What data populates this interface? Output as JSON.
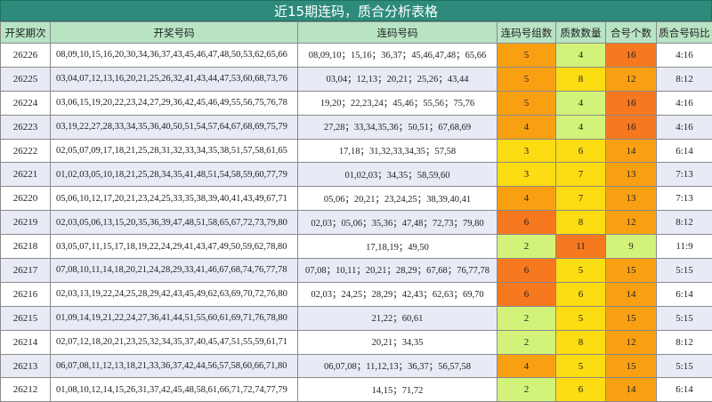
{
  "title": "近15期连码，质合分析表格",
  "headers": [
    "开奖期次",
    "开奖号码",
    "连码号码",
    "连码号组数",
    "质数数量",
    "合号个数",
    "质合号码比"
  ],
  "colors": {
    "red": "#f6781f",
    "orange": "#f9a012",
    "yellow": "#fcdc12",
    "light": "#d3f27a"
  },
  "rows": [
    {
      "issue": "26226",
      "draw": "08,09,10,15,16,20,30,34,36,37,43,45,46,47,48,50,53,62,65,66",
      "lian": "08,09,10；15,16；36,37；45,46,47,48；65,66",
      "groups": "5",
      "gc": "orange",
      "prime": "4",
      "pc": "light",
      "composite": "16",
      "cc": "red",
      "ratio": "4:16"
    },
    {
      "issue": "26225",
      "draw": "03,04,07,12,13,16,20,21,25,26,32,41,43,44,47,53,60,68,73,76",
      "lian": "03,04；12,13；20,21；25,26；43,44",
      "groups": "5",
      "gc": "orange",
      "prime": "8",
      "pc": "yellow",
      "composite": "12",
      "cc": "orange",
      "ratio": "8:12"
    },
    {
      "issue": "26224",
      "draw": "03,06,15,19,20,22,23,24,27,29,36,42,45,46,49,55,56,75,76,78",
      "lian": "19,20；22,23,24；45,46；55,56；75,76",
      "groups": "5",
      "gc": "orange",
      "prime": "4",
      "pc": "light",
      "composite": "16",
      "cc": "red",
      "ratio": "4:16"
    },
    {
      "issue": "26223",
      "draw": "03,19,22,27,28,33,34,35,36,40,50,51,54,57,64,67,68,69,75,79",
      "lian": "27,28；33,34,35,36；50,51；67,68,69",
      "groups": "4",
      "gc": "orange",
      "prime": "4",
      "pc": "light",
      "composite": "16",
      "cc": "red",
      "ratio": "4:16"
    },
    {
      "issue": "26222",
      "draw": "02,05,07,09,17,18,21,25,28,31,32,33,34,35,38,51,57,58,61,65",
      "lian": "17,18；31,32,33,34,35；57,58",
      "groups": "3",
      "gc": "yellow",
      "prime": "6",
      "pc": "yellow",
      "composite": "14",
      "cc": "orange",
      "ratio": "6:14"
    },
    {
      "issue": "26221",
      "draw": "01,02,03,05,10,18,21,25,28,34,35,41,48,51,54,58,59,60,77,79",
      "lian": "01,02,03；34,35；58,59,60",
      "groups": "3",
      "gc": "yellow",
      "prime": "7",
      "pc": "yellow",
      "composite": "13",
      "cc": "orange",
      "ratio": "7:13"
    },
    {
      "issue": "26220",
      "draw": "05,06,10,12,17,20,21,23,24,25,33,35,38,39,40,41,43,49,67,71",
      "lian": "05,06；20,21；23,24,25；38,39,40,41",
      "groups": "4",
      "gc": "orange",
      "prime": "7",
      "pc": "yellow",
      "composite": "13",
      "cc": "orange",
      "ratio": "7:13"
    },
    {
      "issue": "26219",
      "draw": "02,03,05,06,13,15,20,35,36,39,47,48,51,58,65,67,72,73,79,80",
      "lian": "02,03；05,06；35,36；47,48；72,73；79,80",
      "groups": "6",
      "gc": "red",
      "prime": "8",
      "pc": "yellow",
      "composite": "12",
      "cc": "orange",
      "ratio": "8:12"
    },
    {
      "issue": "26218",
      "draw": "03,05,07,11,15,17,18,19,22,24,29,41,43,47,49,50,59,62,78,80",
      "lian": "17,18,19；49,50",
      "groups": "2",
      "gc": "light",
      "prime": "11",
      "pc": "red",
      "composite": "9",
      "cc": "light",
      "ratio": "11:9"
    },
    {
      "issue": "26217",
      "draw": "07,08,10,11,14,18,20,21,24,28,29,33,41,46,67,68,74,76,77,78",
      "lian": "07,08；10,11；20,21；28,29；67,68；76,77,78",
      "groups": "6",
      "gc": "red",
      "prime": "5",
      "pc": "yellow",
      "composite": "15",
      "cc": "orange",
      "ratio": "5:15"
    },
    {
      "issue": "26216",
      "draw": "02,03,13,19,22,24,25,28,29,42,43,45,49,62,63,69,70,72,76,80",
      "lian": "02,03；24,25；28,29；42,43；62,63；69,70",
      "groups": "6",
      "gc": "red",
      "prime": "6",
      "pc": "yellow",
      "composite": "14",
      "cc": "orange",
      "ratio": "6:14"
    },
    {
      "issue": "26215",
      "draw": "01,09,14,19,21,22,24,27,36,41,44,51,55,60,61,69,71,76,78,80",
      "lian": "21,22；60,61",
      "groups": "2",
      "gc": "light",
      "prime": "5",
      "pc": "yellow",
      "composite": "15",
      "cc": "orange",
      "ratio": "5:15"
    },
    {
      "issue": "26214",
      "draw": "02,07,12,18,20,21,23,25,32,34,35,37,40,45,47,51,55,59,61,71",
      "lian": "20,21；34,35",
      "groups": "2",
      "gc": "light",
      "prime": "8",
      "pc": "yellow",
      "composite": "12",
      "cc": "orange",
      "ratio": "8:12"
    },
    {
      "issue": "26213",
      "draw": "06,07,08,11,12,13,18,21,33,36,37,42,44,56,57,58,60,66,71,80",
      "lian": "06,07,08；11,12,13；36,37；56,57,58",
      "groups": "4",
      "gc": "orange",
      "prime": "5",
      "pc": "yellow",
      "composite": "15",
      "cc": "orange",
      "ratio": "5:15"
    },
    {
      "issue": "26212",
      "draw": "01,08,10,12,14,15,26,31,37,42,45,48,58,61,66,71,72,74,77,79",
      "lian": "14,15；71,72",
      "groups": "2",
      "gc": "light",
      "prime": "6",
      "pc": "yellow",
      "composite": "14",
      "cc": "orange",
      "ratio": "6:14"
    }
  ]
}
